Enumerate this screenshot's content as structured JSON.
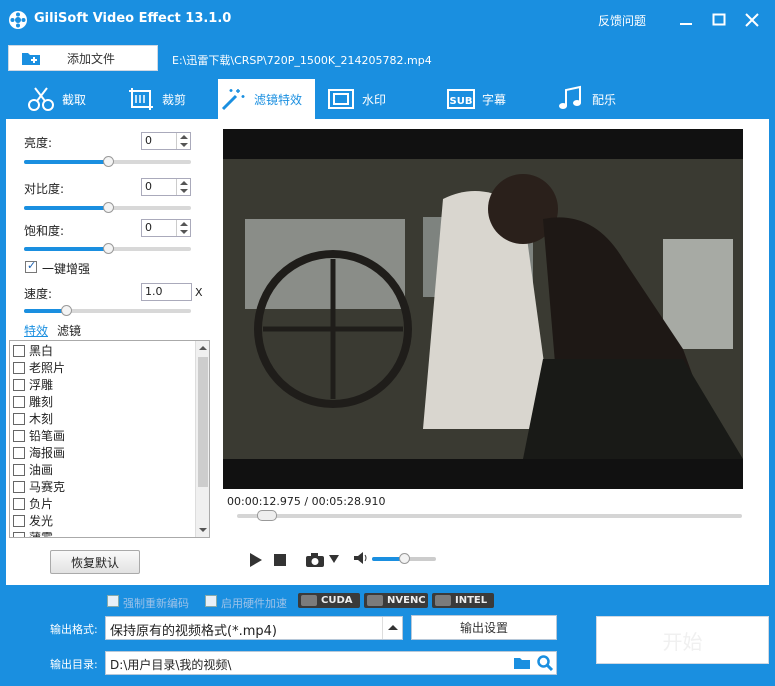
{
  "window": {
    "title": "GiliSoft Video Effect 13.1.0",
    "feedback": "反馈问题"
  },
  "file": {
    "add_label": "添加文件",
    "path": "E:\\迅雷下载\\CRSP\\720P_1500K_214205782.mp4"
  },
  "tabs": [
    {
      "label": "截取",
      "icon": "clip-icon"
    },
    {
      "label": "裁剪",
      "icon": "crop-icon"
    },
    {
      "label": "滤镜特效",
      "icon": "magic-wand-icon",
      "active": true
    },
    {
      "label": "水印",
      "icon": "watermark-icon"
    },
    {
      "label": "字幕",
      "icon": "subtitle-icon"
    },
    {
      "label": "配乐",
      "icon": "music-icon"
    }
  ],
  "adjust": {
    "brightness_label": "亮度:",
    "brightness_value": "0",
    "brightness_level": 0.5,
    "contrast_label": "对比度:",
    "contrast_value": "0",
    "contrast_level": 0.5,
    "saturation_label": "饱和度:",
    "saturation_value": "0",
    "saturation_level": 0.5,
    "enhance_label": "一键增强",
    "enhance_checked": true,
    "speed_label": "速度:",
    "speed_value": "1.0",
    "speed_unit": "X",
    "speed_level": 0.25
  },
  "subtabs": {
    "effects": "特效",
    "filters": "滤镜"
  },
  "effects": [
    "黑白",
    "老照片",
    "浮雕",
    "雕刻",
    "木刻",
    "铅笔画",
    "海报画",
    "油画",
    "马赛克",
    "负片",
    "发光",
    "薄雾"
  ],
  "restore_label": "恢复默认",
  "player": {
    "time": "00:00:12.975 / 00:05:28.910",
    "progress": 0.04,
    "volume": 0.5
  },
  "hw": {
    "reencode_label": "强制重新编码",
    "hw_accel_label": "启用硬件加速",
    "cuda": "CUDA",
    "nvenc": "NVENC",
    "intel": "INTEL"
  },
  "output": {
    "format_label": "输出格式:",
    "format_value": "保持原有的视频格式(*.mp4)",
    "settings_label": "输出设置",
    "dir_label": "输出目录:",
    "dir_value": "D:\\用户目录\\我的视频\\",
    "start_label": "开始"
  },
  "colors": {
    "accent": "#1a8fe0",
    "panel": "#ffffff"
  }
}
